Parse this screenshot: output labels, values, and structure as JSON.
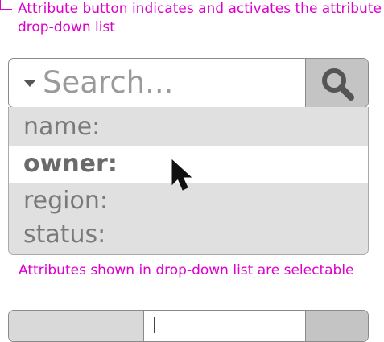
{
  "annotations": {
    "top": "Attribute button indicates and activates the attribute drop-down list",
    "bottom": "Attributes shown in drop-down list are selectable"
  },
  "search": {
    "placeholder": "Search...",
    "attribute_button_icon": "triangle-down-icon",
    "search_button_icon": "magnifier-icon"
  },
  "dropdown": {
    "items": [
      "name:",
      "owner:",
      "region:",
      "status:"
    ],
    "selected": "owner:"
  },
  "colors": {
    "annotation": "#dd00cc",
    "dropdown_bg": "#e0e0e0",
    "search_button_bg": "#c4c4c4"
  }
}
